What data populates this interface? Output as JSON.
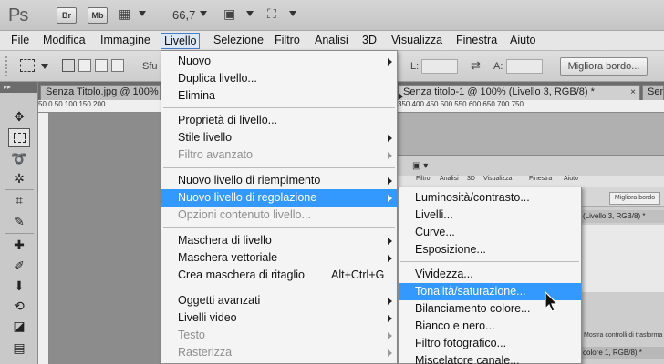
{
  "app": {
    "logo": "Ps",
    "bridge_label": "Br",
    "minibridge_label": "Mb",
    "zoom": "66,7"
  },
  "menubar": [
    "File",
    "Modifica",
    "Immagine",
    "Livello",
    "Selezione",
    "Filtro",
    "Analisi",
    "3D",
    "Visualizza",
    "Finestra",
    "Aiuto"
  ],
  "options": {
    "feather_prefix": "Sfu",
    "width_label": "L:",
    "height_label": "A:",
    "refine_button": "Migliora bordo..."
  },
  "tabs": [
    {
      "label": "Senza Titolo.jpg @ 100% (Li",
      "close": "×"
    },
    {
      "label": "Senza titolo-1 @ 100% (Livello 3, RGB/8) *",
      "close": "×"
    },
    {
      "label": "Sen",
      "close": ""
    }
  ],
  "toolbox_header": "▸▸",
  "ruler_numbers": "50  0  50  100  150  200",
  "bg_ruler_numbers": "350  400  450  500  550  600  650  700  750",
  "nested": {
    "menu": [
      "Filtro",
      "Analisi",
      "3D",
      "Visualizza",
      "Finestra",
      "Aiuto"
    ],
    "refine": "Migliora bordo",
    "tab_label": "(Livello 3, RGB/8) *",
    "hint": "Mostra controlli di trasforma",
    "tab2_label": "colore 1, RGB/8) *"
  },
  "layer_menu": {
    "items": [
      {
        "label": "Nuovo",
        "submenu": true
      },
      {
        "label": "Duplica livello..."
      },
      {
        "label": "Elimina",
        "submenu": true
      },
      {
        "sep": true
      },
      {
        "label": "Proprietà di livello..."
      },
      {
        "label": "Stile livello",
        "submenu": true
      },
      {
        "label": "Filtro avanzato",
        "disabled": true,
        "submenu": true
      },
      {
        "sep": true
      },
      {
        "label": "Nuovo livello di riempimento",
        "submenu": true
      },
      {
        "label": "Nuovo livello di regolazione",
        "submenu": true,
        "highlight": true
      },
      {
        "label": "Opzioni contenuto livello...",
        "disabled": true
      },
      {
        "sep": true
      },
      {
        "label": "Maschera di livello",
        "submenu": true
      },
      {
        "label": "Maschera vettoriale",
        "submenu": true
      },
      {
        "label": "Crea maschera di ritaglio",
        "shortcut": "Alt+Ctrl+G"
      },
      {
        "sep": true
      },
      {
        "label": "Oggetti avanzati",
        "submenu": true
      },
      {
        "label": "Livelli video",
        "submenu": true
      },
      {
        "label": "Testo",
        "disabled": true,
        "submenu": true
      },
      {
        "label": "Rasterizza",
        "disabled": true,
        "submenu": true
      }
    ]
  },
  "adjust_submenu": {
    "items": [
      {
        "label": "Luminosità/contrasto..."
      },
      {
        "label": "Livelli..."
      },
      {
        "label": "Curve..."
      },
      {
        "label": "Esposizione..."
      },
      {
        "sep": true
      },
      {
        "label": "Vividezza..."
      },
      {
        "label": "Tonalità/saturazione...",
        "highlight": true
      },
      {
        "label": "Bilanciamento colore..."
      },
      {
        "label": "Bianco e nero..."
      },
      {
        "label": "Filtro fotografico..."
      },
      {
        "label": "Miscelatore canale..."
      }
    ]
  },
  "colors": {
    "highlight": "#3399ff",
    "menu_bg": "#f4f4f4",
    "disabled_text": "#8e8e8e"
  },
  "tool_icons": [
    "move-icon",
    "marquee-icon",
    "lasso-icon",
    "magic-wand-icon",
    "crop-icon",
    "eyedropper-icon",
    "healing-icon",
    "brush-icon",
    "stamp-icon",
    "history-brush-icon",
    "eraser-icon",
    "gradient-icon"
  ]
}
